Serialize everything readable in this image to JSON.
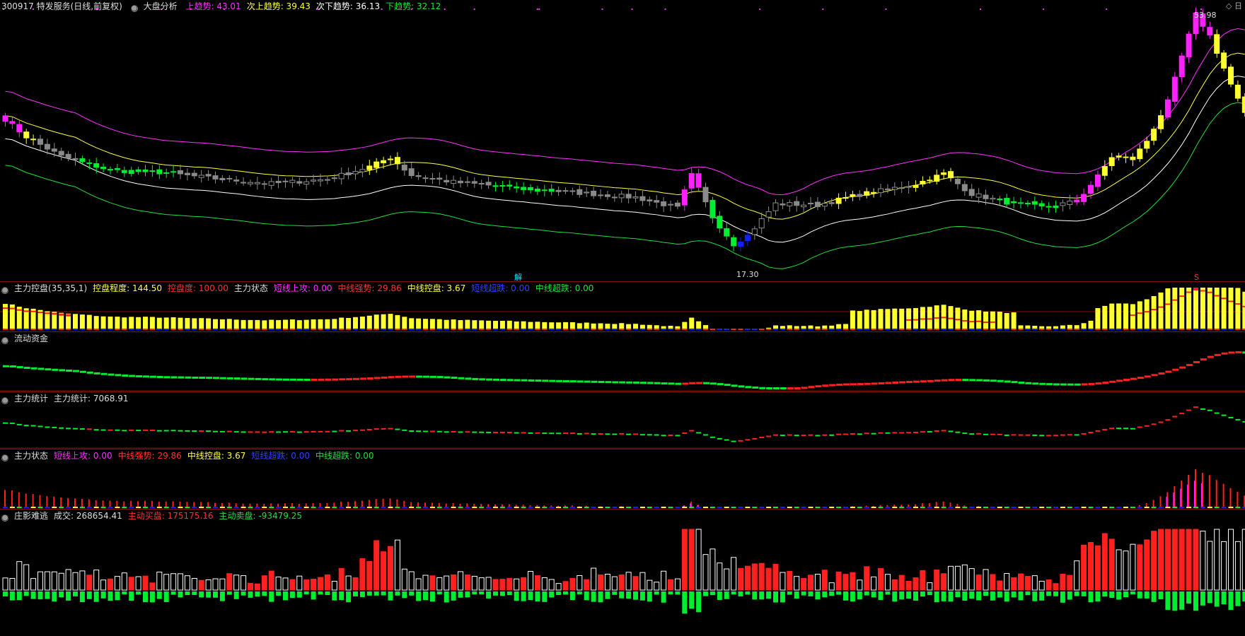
{
  "colors": {
    "up": "#ff2020",
    "down": "#00ee30",
    "gray": "#8a8a8a",
    "yellow": "#ffff30",
    "magenta": "#ff20ff",
    "blue": "#1020ff",
    "white": "#ffffff",
    "grid": "#8a1010"
  },
  "main": {
    "stock": "300917 特发服务(日线,前复权)",
    "indicator": "大盘分析",
    "trend_items": [
      {
        "label": "上趋势: 43.01",
        "color": "#ff30ff"
      },
      {
        "label": "次上趋势: 39.43",
        "color": "#ffff40"
      },
      {
        "label": "次下趋势: 36.13",
        "color": "#ffffff"
      },
      {
        "label": "下趋势: 32.12",
        "color": "#20e040"
      }
    ],
    "high_label": "53.98",
    "low_label": "17.30",
    "marker_jie": "解",
    "marker_s": "S",
    "corner": "◇ 日"
  },
  "p1": {
    "title": "主力控盘(35,35,1)",
    "items": [
      {
        "label": "控盘程度: 144.50",
        "color": "#ffff40"
      },
      {
        "label": "控盘度: 100.00",
        "color": "#ff3030"
      },
      {
        "label": "主力状态",
        "color": "#dddddd"
      },
      {
        "label": "短线上攻: 0.00",
        "color": "#ff30ff"
      },
      {
        "label": "中线强势: 29.86",
        "color": "#ff3030"
      },
      {
        "label": "中线控盘: 3.67",
        "color": "#ffff40"
      },
      {
        "label": "短线超跌: 0.00",
        "color": "#3040ff"
      },
      {
        "label": "中线超跌: 0.00",
        "color": "#20e040"
      }
    ]
  },
  "p2": {
    "title": "流动资金"
  },
  "p3": {
    "title": "主力统计",
    "items": [
      {
        "label": "主力统计: 7068.91",
        "color": "#dddddd"
      }
    ]
  },
  "p4": {
    "title": "主力状态",
    "items": [
      {
        "label": "短线上攻: 0.00",
        "color": "#ff30ff"
      },
      {
        "label": "中线强势: 29.86",
        "color": "#ff3030"
      },
      {
        "label": "中线控盘: 3.67",
        "color": "#ffff40"
      },
      {
        "label": "短线超跌: 0.00",
        "color": "#3040ff"
      },
      {
        "label": "中线超跌: 0.00",
        "color": "#20e040"
      }
    ]
  },
  "p5": {
    "title": "庄影难逃",
    "items": [
      {
        "label": "成交: 268654.41",
        "color": "#dddddd"
      },
      {
        "label": "主动买盘: 175175.16",
        "color": "#ff3030"
      },
      {
        "label": "主动卖盘: -93479.25",
        "color": "#20e040"
      }
    ]
  },
  "chart_data": {
    "type": "candlestick",
    "price_range": [
      17.3,
      53.98
    ],
    "anchor_closes": [
      [
        0,
        38.5
      ],
      [
        3,
        36
      ],
      [
        8,
        33.2
      ],
      [
        15,
        31.2
      ],
      [
        22,
        30.9
      ],
      [
        30,
        30
      ],
      [
        38,
        29.3
      ],
      [
        46,
        29.9
      ],
      [
        52,
        31.7
      ],
      [
        55,
        33
      ],
      [
        58,
        30.5
      ],
      [
        64,
        29.5
      ],
      [
        72,
        28.8
      ],
      [
        80,
        28.1
      ],
      [
        90,
        27.3
      ],
      [
        96,
        25.8
      ],
      [
        98,
        30.5
      ],
      [
        101,
        24.5
      ],
      [
        104,
        20.6
      ],
      [
        106,
        21.8
      ],
      [
        110,
        26.4
      ],
      [
        116,
        26.2
      ],
      [
        122,
        27.7
      ],
      [
        130,
        29.2
      ],
      [
        134,
        30.7
      ],
      [
        138,
        27.8
      ],
      [
        143,
        26.6
      ],
      [
        148,
        25.9
      ],
      [
        153,
        26.7
      ],
      [
        156,
        30.3
      ],
      [
        158,
        33.1
      ],
      [
        161,
        32.8
      ],
      [
        163,
        35.4
      ],
      [
        166,
        41
      ],
      [
        168,
        47.5
      ],
      [
        170,
        53.5
      ],
      [
        172,
        50.5
      ],
      [
        175,
        43.5
      ],
      [
        177,
        39.2
      ]
    ],
    "color_bands": [
      [
        0,
        2,
        "magenta"
      ],
      [
        3,
        4,
        "yellow"
      ],
      [
        5,
        8,
        "gray"
      ],
      [
        11,
        24,
        "green"
      ],
      [
        52,
        56,
        "yellow"
      ],
      [
        70,
        78,
        "green"
      ],
      [
        97,
        99,
        "magenta"
      ],
      [
        101,
        104,
        "green"
      ],
      [
        104,
        106,
        "blue"
      ],
      [
        119,
        121,
        "yellow"
      ],
      [
        123,
        124,
        "yellow"
      ],
      [
        130,
        135,
        "yellow"
      ],
      [
        142,
        150,
        "green"
      ],
      [
        153,
        156,
        "magenta"
      ],
      [
        156,
        165,
        "yellow"
      ],
      [
        165,
        172,
        "magenta"
      ],
      [
        172,
        177,
        "yellow"
      ]
    ],
    "overlay_lines": [
      "上趋势",
      "次上趋势",
      "次下趋势",
      "下趋势"
    ]
  }
}
